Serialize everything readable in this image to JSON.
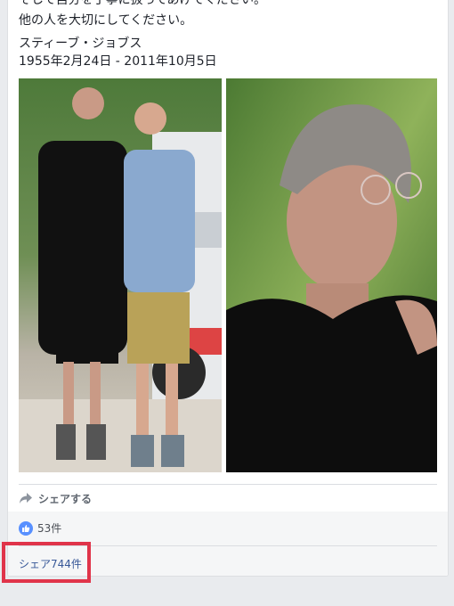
{
  "post": {
    "cut_line": "そして自分を丁寧に扱ってあげてください。",
    "line_others": "他の人を大切にしてください。",
    "name": "スティーブ・ジョブス",
    "dates": "1955年2月24日 - 2011年10月5日"
  },
  "actions": {
    "share_label": "シェアする",
    "share_icon": "share-arrow-icon"
  },
  "reactions": {
    "like_count": "53件",
    "like_icon": "thumbs-up-icon",
    "like_color": "#5890ff",
    "share_count": "シェア744件"
  },
  "colors": {
    "highlight": "#e0344a",
    "link": "#385898",
    "background": "#e9ebee"
  }
}
